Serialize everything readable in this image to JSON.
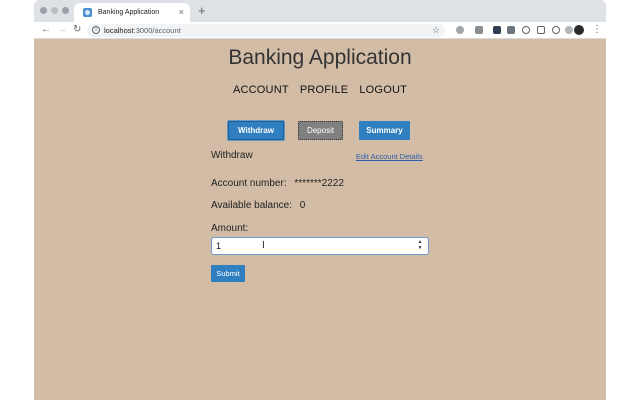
{
  "browser": {
    "tab_title": "Banking Application",
    "tab_close": "×",
    "new_tab": "+",
    "url_host": "localhost",
    "url_path": ":3000/account",
    "icons": [
      "back-icon",
      "forward-icon",
      "reload-icon",
      "info-icon",
      "star-icon",
      "menu-icon"
    ]
  },
  "app": {
    "title": "Banking Application",
    "nav": [
      "ACCOUNT",
      "PROFILE",
      "LOGOUT"
    ]
  },
  "actions": {
    "withdraw": "Withdraw",
    "deposit": "Deposit",
    "summary": "Summary"
  },
  "form": {
    "section_title": "Withdraw",
    "edit_link": "Edit Account Details",
    "account_label": "Account number:",
    "account_value": "*******2222",
    "balance_label": "Available balance:",
    "balance_value": "0",
    "amount_label": "Amount:",
    "amount_value": "1",
    "submit": "Submit"
  },
  "colors": {
    "page_bg": "#d2bca6",
    "primary": "#2f7fc1",
    "active_btn": "#808080"
  }
}
